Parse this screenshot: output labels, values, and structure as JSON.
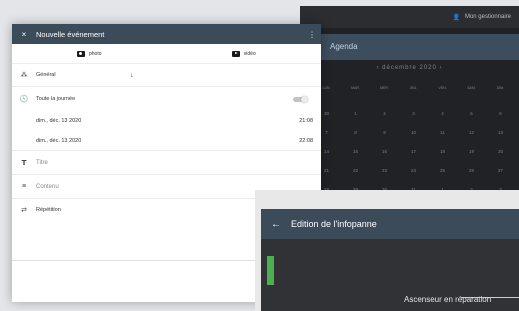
{
  "background": {
    "account_label": "Mon gestionnaire",
    "agenda_title": "Agenda",
    "month_label": "‹ décembre 2020 ›",
    "weekdays": [
      "LUN.",
      "MAR.",
      "MER.",
      "JEU.",
      "VEN.",
      "SAM.",
      "DIM."
    ],
    "weeks": [
      [
        "30",
        "1",
        "2",
        "3",
        "4",
        "5",
        "6"
      ],
      [
        "7",
        "8",
        "9",
        "10",
        "11",
        "12",
        "13"
      ],
      [
        "14",
        "15",
        "16",
        "17",
        "18",
        "19",
        "20"
      ],
      [
        "21",
        "22",
        "23",
        "24",
        "25",
        "26",
        "27"
      ],
      [
        "28",
        "29",
        "30",
        "31",
        "1",
        "2",
        "3"
      ]
    ]
  },
  "dialog": {
    "title": "Nouvelle événement",
    "close_icon": "×",
    "menu_icon": "⋮",
    "photo_label": "photo",
    "video_label": "vidéo",
    "general_label": "Général",
    "all_day_label": "Toute la journée",
    "all_day_on": true,
    "start_date": "dim., déc. 13 2020",
    "start_time": "21:08",
    "end_date": "dim., déc. 13 2020",
    "end_time": "22:08",
    "title_placeholder": "Titre",
    "content_placeholder": "Contenu",
    "repeat_label": "Répétition"
  },
  "infopanne": {
    "title": "Edition de l'infopanne",
    "back_icon": "←",
    "body_text": "Ascenseur en réparation",
    "accent": "#4caf50"
  }
}
